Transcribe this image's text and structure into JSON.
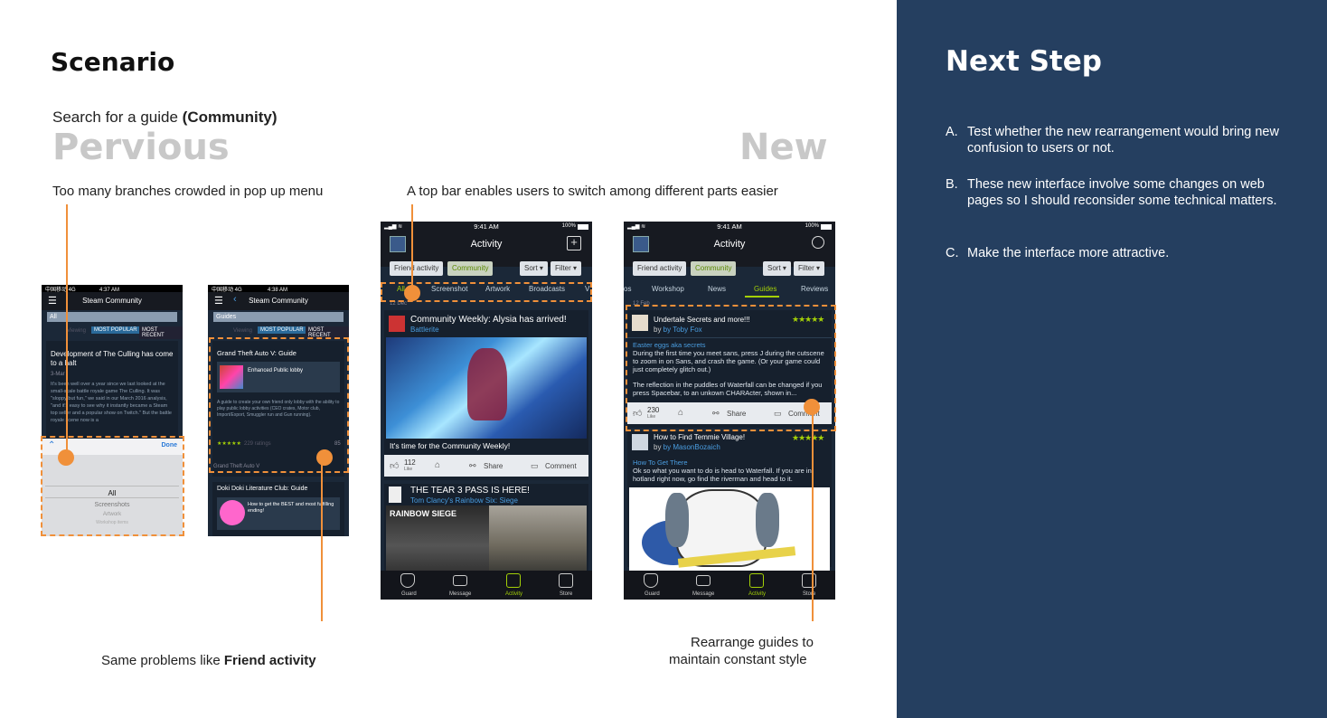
{
  "left": {
    "title": "Scenario",
    "task_prefix": "Search for a guide ",
    "task_bold": "(Community)",
    "previous_heading": "Pervious",
    "new_heading": "New",
    "caption_prev": "Too many branches crowded in pop up menu",
    "caption_new": "A top bar enables users to switch among different parts easier",
    "caption_same_prefix": "Same problems like ",
    "caption_same_bold": "Friend activity",
    "caption_rearrange_1": "Rearrange guides to",
    "caption_rearrange_2": "maintain constant style"
  },
  "next": {
    "title": "Next Step",
    "steps": [
      {
        "letter": "A.",
        "text": "Test whether the new rearrangement would bring new confusion to users or not."
      },
      {
        "letter": "B.",
        "text": "These new interface involve some changes on web pages so I should reconsider some technical matters."
      },
      {
        "letter": "C.",
        "text": "Make the interface more attractive."
      }
    ]
  },
  "phone1": {
    "status_carrier": "中国移动 4G",
    "time": "4:37 AM",
    "title": "Steam Community",
    "search_value": "All",
    "tab_viewing": "Viewing",
    "tab_popular": "MOST POPULAR",
    "tab_recent": "MOST RECENT",
    "post_title": "Development of The Culling has come to a halt",
    "post_date": "3-Mar",
    "post_body": "It's been well over a year since we last looked at the small-scale battle royale game The Culling. It was \"sloppy but fun,\" we said in our March 2016 analysis, \"and it's easy to see why it instantly became a Steam top seller and a popular show on Twitch.\" But the battle royale scene now is a",
    "picker_done": "Done",
    "picker_selected": "All",
    "picker_opt1": "Screenshots",
    "picker_opt2": "Artwork",
    "picker_opt3": "Workshop items"
  },
  "phone2": {
    "status_carrier": "中国移动 4G",
    "time": "4:38 AM",
    "title": "Steam Community",
    "search_value": "Guides",
    "tab_viewing": "Viewing",
    "tab_popular": "MOST POPULAR",
    "tab_recent": "MOST RECENT",
    "g1_title": "Grand Theft Auto V: Guide",
    "g1_subtitle": "Enhanced Public lobby",
    "g1_body": "A guide to create your own friend only lobby with the ability to play public lobby activities (CEO crates, Motor club, Import/Export, Smuggler run and Gun running).",
    "g1_ratings": "229 ratings",
    "g1_count": "85",
    "g1_footer": "Grand Theft Auto V",
    "g2_title": "Doki Doki Literature Club: Guide",
    "g2_subtitle": "How to get the BEST and most fulfilling ending!"
  },
  "phone3": {
    "time": "9:41 AM",
    "battery": "100%",
    "title": "Activity",
    "pill_friend": "Friend activity",
    "pill_community": "Community",
    "sort": "Sort",
    "filter": "Filter",
    "tabs": [
      "All",
      "Screenshot",
      "Artwork",
      "Broadcasts",
      "V"
    ],
    "date": "12 Dec",
    "post1_title": "Community Weekly: Alysia has arrived!",
    "post1_source": "Battlerite",
    "post1_caption": "It's time for the Community Weekly!",
    "like_count": "112",
    "like_label": "Like",
    "share_label": "Share",
    "comment_label": "Comment",
    "post2_title": "THE TEAR 3 PASS IS HERE!",
    "post2_source": "Tom Clancy's Rainbow Six: Siege",
    "banner_text": "RAINBOW SIEGE",
    "nav": [
      "Guard",
      "Message",
      "Activity",
      "Store"
    ]
  },
  "phone4": {
    "time": "9:41 AM",
    "battery": "100%",
    "title": "Activity",
    "pill_friend": "Friend activity",
    "pill_community": "Community",
    "sort": "Sort",
    "filter": "Filter",
    "tabs": [
      "os",
      "Workshop",
      "News",
      "Guides",
      "Reviews"
    ],
    "date": "12 Feb",
    "g1_title": "Undertale Secrets and more!!!",
    "g1_author": "by Toby Fox",
    "g1_stars": "★★★★★",
    "g1_section": "Easter eggs aka secrets",
    "g1_body1": "During the first time you meet sans, press J during the cutscene to zoom in on Sans, and crash the game. (Or your game could just completely glitch out.)",
    "g1_body2": "The reflection in the puddles of Waterfall can be changed if you press Spacebar, to an unkown CHARActer, shown in...",
    "like_count": "230",
    "like_label": "Like",
    "share_label": "Share",
    "comment_label": "Comment",
    "g2_title": "How to Find Temmie Village!",
    "g2_author": "by MasonBozaich",
    "g2_stars": "★★★★★",
    "g2_section": "How To Get There",
    "g2_body": "Ok so what you want to do is head to Waterfall. If you are in hotland right now, go find the riverman and head to it.",
    "nav": [
      "Guard",
      "Message",
      "Activity",
      "Store"
    ]
  },
  "colors": {
    "accent": "#f0903a",
    "panel": "#253f60",
    "steam_bg": "#1b2838",
    "steam_green": "#a4d007",
    "steam_link": "#4a9de0"
  }
}
